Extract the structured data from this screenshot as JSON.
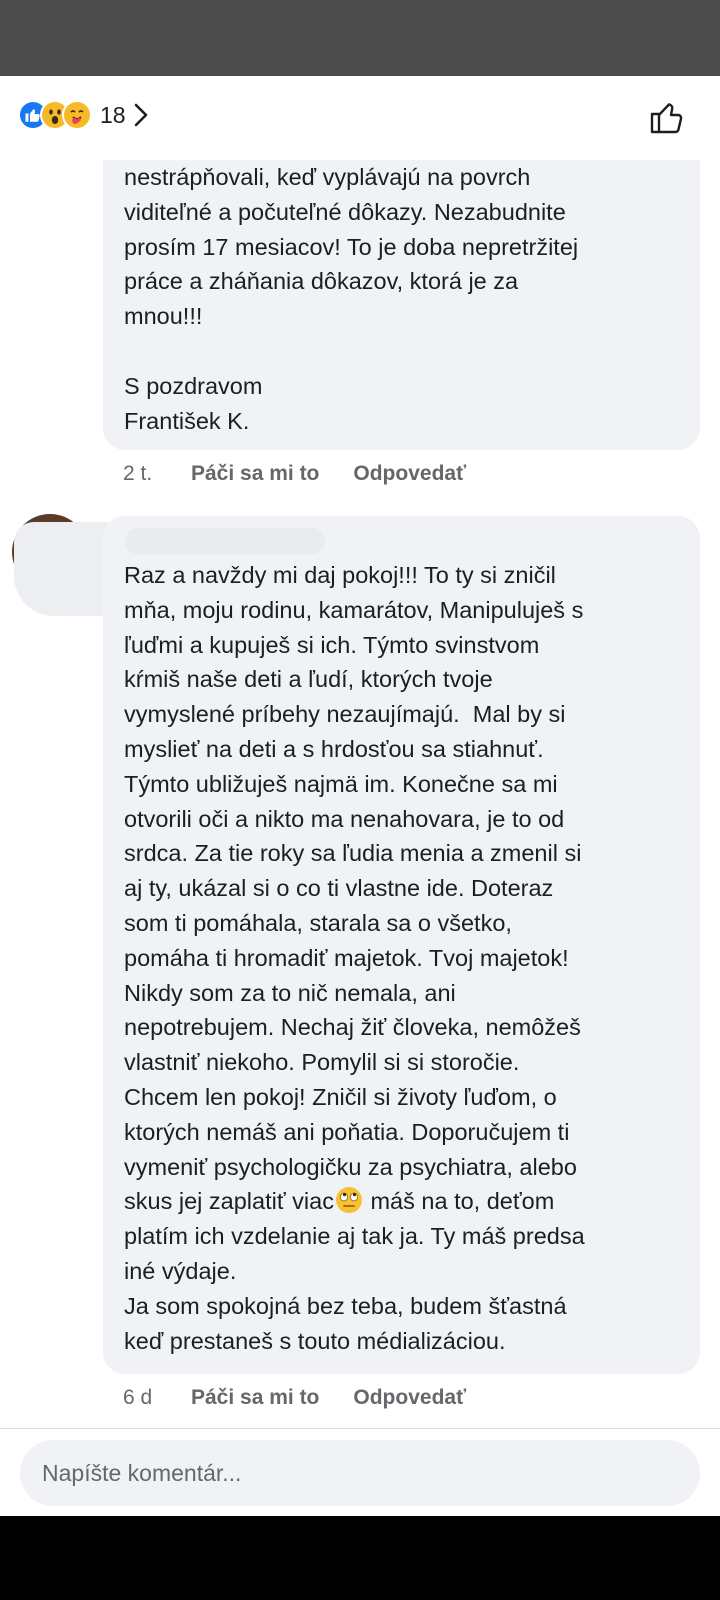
{
  "reactions": {
    "count": "18",
    "types": [
      "like",
      "wow",
      "care"
    ],
    "colors": {
      "like": "#1877f2",
      "emoji": "#f7b928"
    }
  },
  "comments": [
    {
      "text": "nestrápňovali, keď vyplávajú na povrch\nviditeľné a počuteľné dôkazy. Nezabudnite\nprosím 17 mesiacov! To je doba nepretržitej\npráce a zháňania dôkazov, ktorá je za\nmnou!!!\n\nS pozdravom\nFrantišek K.",
      "time": "2 t.",
      "like_label": "Páči sa mi to",
      "reply_label": "Odpovedať"
    },
    {
      "text_part1": "Raz a navždy mi daj pokoj!!! To ty si zničil\nmňa, moju rodinu, kamarátov, Manipuluješ s\nľuďmi a kupuješ si ich. Týmto svinstvom\nkŕmiš naše deti a ľudí, ktorých tvoje\nvymyslené príbehy nezaujímajú.  Mal by si\nmyslieť na deti a s hrdosťou sa stiahnuť.\nTýmto ubližuješ najmä im. Konečne sa mi\notvorili oči a nikto ma nenahovara, je to od\nsrdca. Za tie roky sa ľudia menia a zmenil si\naj ty, ukázal si o co ti vlastne ide. Doteraz\nsom ti pomáhala, starala sa o všetko,\npomáha ti hromadiť majetok. Tvoj majetok!\nNikdy som za to nič nemala, ani\nnepotrebujem. Nechaj žiť človeka, nemôžeš\nvlastniť niekoho. Pomylil si si storočie.\nChcem len pokoj! Zničil si životy ľuďom, o\nktorých nemáš ani poňatia. Doporučujem ti\nvymeniť psychologičku za psychiatra, alebo\nskus jej zaplatiť viac",
      "emoji": "eye-roll-emoji",
      "text_part2": " máš na to, deťom\nplatím ich vzdelanie aj tak ja. Ty máš predsa\niné výdaje.\nJa som spokojná bez teba, budem šťastná\nkeď prestaneš s touto médializáciou.",
      "time": "6 d",
      "like_label": "Páči sa mi to",
      "reply_label": "Odpovedať"
    }
  ],
  "composer": {
    "placeholder": "Napíšte komentár..."
  }
}
